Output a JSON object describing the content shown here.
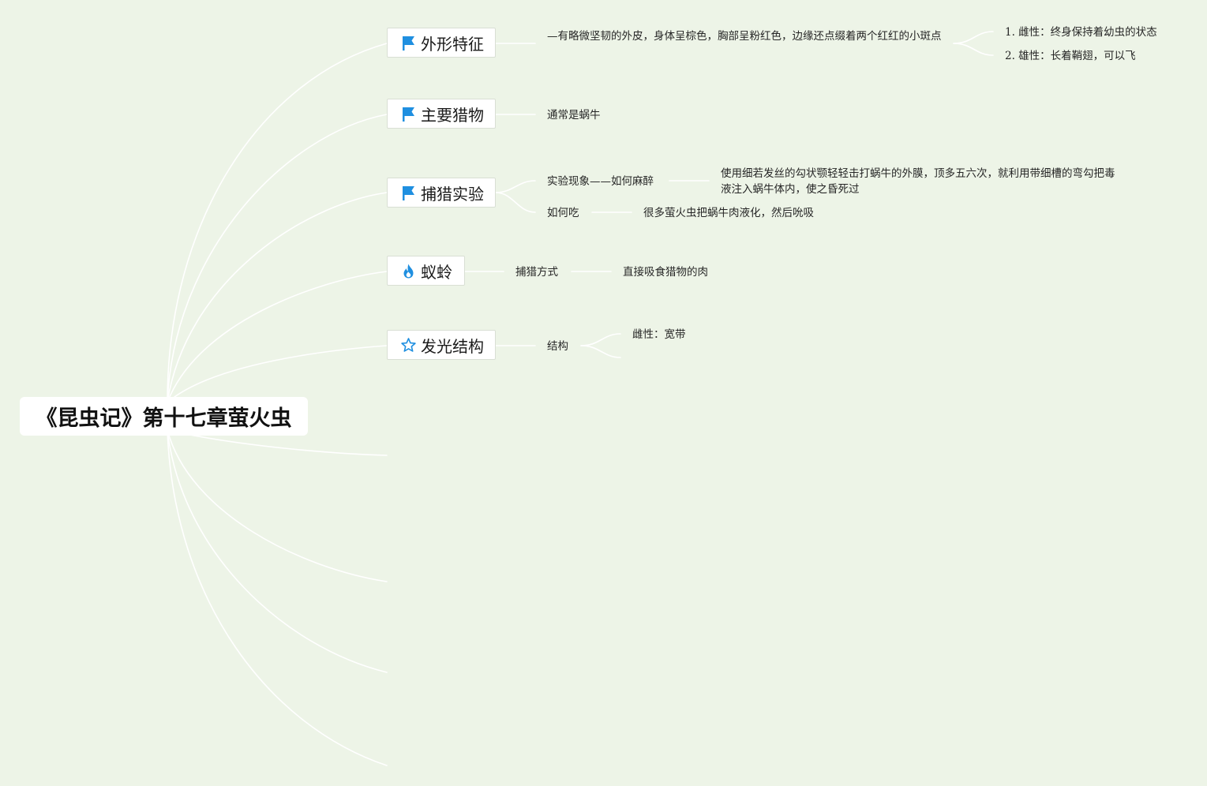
{
  "root": {
    "label": "《昆虫记》第十七章萤火虫"
  },
  "branches": [
    {
      "label": "外形特征",
      "icon": "flag-icon",
      "children": [
        {
          "label": "—有略微坚韧的外皮，身体呈棕色，胸部呈粉红色，边缘还点缀着两个红红的小斑点"
        },
        {
          "label": "1. 雌性：终身保持着幼虫的状态"
        },
        {
          "label": "2. 雄性：长着鞘翅，可以飞"
        }
      ]
    },
    {
      "label": "主要猎物",
      "icon": "flag-icon",
      "children": [
        {
          "label": "通常是蜗牛"
        }
      ]
    },
    {
      "label": "捕猎实验",
      "icon": "flag-icon",
      "children": [
        {
          "label": "实验现象——如何麻醉"
        },
        {
          "label": "使用细若发丝的勾状颚轻轻击打蜗牛的外膜，顶多五六次，就利用带细槽的弯勾把毒液注入蜗牛体内，使之昏死过"
        },
        {
          "label": "如何吃"
        },
        {
          "label": "很多萤火虫把蜗牛肉液化，然后吮吸"
        }
      ]
    },
    {
      "label": "蚁蛉",
      "icon": "fire-icon",
      "children": [
        {
          "label": "捕猎方式"
        },
        {
          "label": "直接吸食猎物的肉"
        }
      ]
    },
    {
      "label": "发光结构",
      "icon": "star-icon",
      "children": [
        {
          "label": "结构"
        },
        {
          "label": "雌性：宽带"
        }
      ]
    }
  ],
  "colors": {
    "background": "#edf4e7",
    "connector": "#ffffff",
    "icon_accent": "#1f8fe0"
  }
}
